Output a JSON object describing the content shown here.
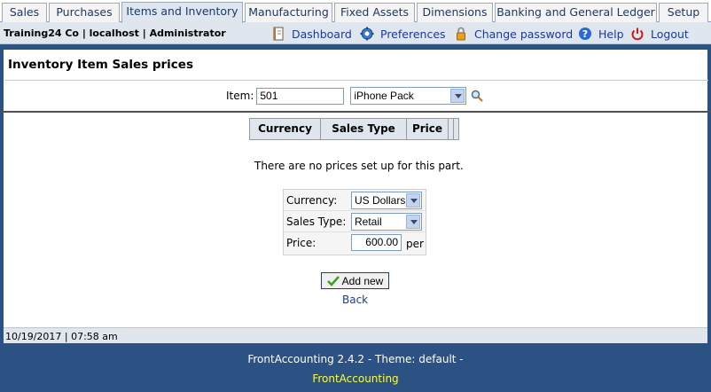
{
  "tabs": [
    {
      "label": "Sales"
    },
    {
      "label": "Purchases"
    },
    {
      "label": "Items and Inventory"
    },
    {
      "label": "Manufacturing"
    },
    {
      "label": "Fixed Assets"
    },
    {
      "label": "Dimensions"
    },
    {
      "label": "Banking and General Ledger"
    },
    {
      "label": "Setup"
    }
  ],
  "header": {
    "company": "Training24 Co | localhost | Administrator",
    "links": {
      "dashboard": "Dashboard",
      "preferences": "Preferences",
      "change_password": "Change password",
      "help": "Help",
      "logout": "Logout"
    }
  },
  "page": {
    "title": "Inventory Item Sales prices",
    "item_label": "Item:",
    "item_code": "501",
    "item_selected": "iPhone Pack"
  },
  "grid": {
    "columns": [
      "Currency",
      "Sales Type",
      "Price"
    ],
    "empty_message": "There are no prices set up for this part."
  },
  "form": {
    "currency_label": "Currency:",
    "currency_value": "US Dollars",
    "sales_type_label": "Sales Type:",
    "sales_type_value": "Retail",
    "price_label": "Price:",
    "price_value": "600.00",
    "price_suffix": "per",
    "add_button": "Add new",
    "back_link": "Back"
  },
  "status": {
    "datetime": "10/19/2017 | 07:58 am"
  },
  "footer": {
    "version": "FrontAccounting 2.4.2 - Theme: default -",
    "link": "FrontAccounting"
  }
}
